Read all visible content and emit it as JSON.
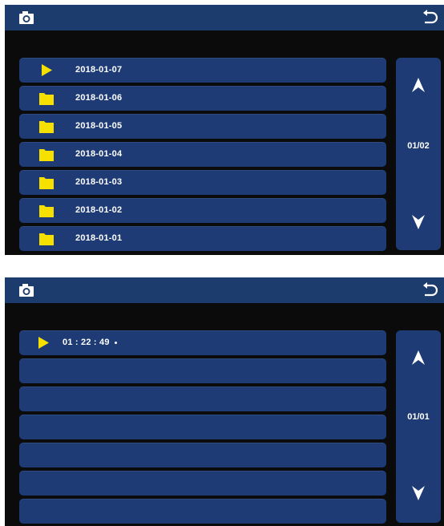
{
  "icons": {
    "camera": "camera-icon",
    "back": "back-arrow-icon",
    "play": "play-icon",
    "folder": "folder-icon",
    "up": "up-arrow-icon",
    "down": "down-arrow-icon"
  },
  "colors": {
    "header": "#1d3c6e",
    "row": "#1e3b75",
    "background": "#0b0b0b",
    "accent": "#f5e000"
  },
  "screen1": {
    "rows": [
      {
        "label": "2018-01-07",
        "icon": "play-icon"
      },
      {
        "label": "2018-01-06",
        "icon": "folder-icon"
      },
      {
        "label": "2018-01-05",
        "icon": "folder-icon"
      },
      {
        "label": "2018-01-04",
        "icon": "folder-icon"
      },
      {
        "label": "2018-01-03",
        "icon": "folder-icon"
      },
      {
        "label": "2018-01-02",
        "icon": "folder-icon"
      },
      {
        "label": "2018-01-01",
        "icon": "folder-icon"
      }
    ],
    "page": "01/02"
  },
  "screen2": {
    "rows": [
      {
        "label": "01 : 22 : 49",
        "icon": "play-icon"
      },
      {
        "label": ""
      },
      {
        "label": ""
      },
      {
        "label": ""
      },
      {
        "label": ""
      },
      {
        "label": ""
      },
      {
        "label": ""
      }
    ],
    "page": "01/01"
  }
}
